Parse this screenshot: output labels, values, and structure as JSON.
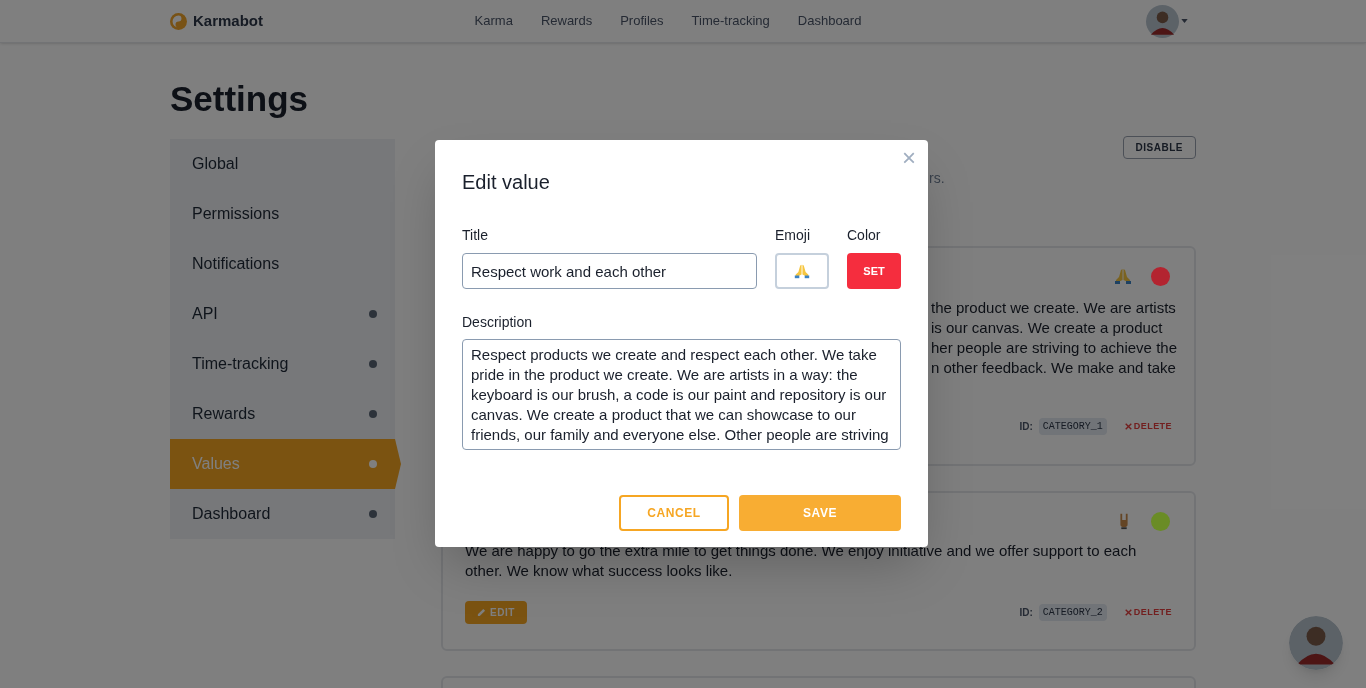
{
  "header": {
    "brand": "Karmabot",
    "nav": [
      {
        "label": "Karma",
        "selected": false
      },
      {
        "label": "Rewards",
        "selected": false
      },
      {
        "label": "Profiles",
        "selected": false
      },
      {
        "label": "Time-tracking",
        "selected": false
      },
      {
        "label": "Dashboard",
        "selected": false
      }
    ]
  },
  "page_title": "Settings",
  "sidebar": {
    "items": [
      {
        "label": "Global",
        "selected": false,
        "dot": false
      },
      {
        "label": "Permissions",
        "selected": false,
        "dot": false
      },
      {
        "label": "Notifications",
        "selected": false,
        "dot": false
      },
      {
        "label": "API",
        "selected": false,
        "dot": true
      },
      {
        "label": "Time-tracking",
        "selected": false,
        "dot": true
      },
      {
        "label": "Rewards",
        "selected": false,
        "dot": true
      },
      {
        "label": "Values",
        "selected": true,
        "dot": true
      },
      {
        "label": "Dashboard",
        "selected": false,
        "dot": true
      }
    ]
  },
  "content": {
    "disable_button": "DISABLE",
    "subtitle_fragment": "rs.",
    "cards": [
      {
        "color": "#b32430",
        "description_lines": [
          "the product we create. We are artists",
          "is our canvas. We create a product",
          "her people are striving to achieve the",
          "n other feedback. We make and take"
        ],
        "id_label": "ID:",
        "id": "CATEGORY_1",
        "delete": "DELETE"
      },
      {
        "color": "#6a8c26",
        "description": "We are happy to go the extra mile to get things done. We enjoy initiative and we offer support to each other. We know what success looks like.",
        "edit": "EDIT",
        "id_label": "ID:",
        "id": "CATEGORY_2",
        "delete": "DELETE"
      }
    ]
  },
  "modal": {
    "title": "Edit value",
    "close": "×",
    "title_label": "Title",
    "title_value": "Respect work and each other",
    "emoji_label": "Emoji",
    "color_label": "Color",
    "color_button": "SET",
    "color": "#f52d3e",
    "description_label": "Description",
    "description_value": "Respect products we create and respect each other. We take pride in the product we create. We are artists in a way: the keyboard is our brush, a code is our paint and repository is our canvas. We create a product that we can showcase to our friends, our family and everyone else. Other people are striving",
    "cancel": "CANCEL",
    "save": "SAVE"
  }
}
